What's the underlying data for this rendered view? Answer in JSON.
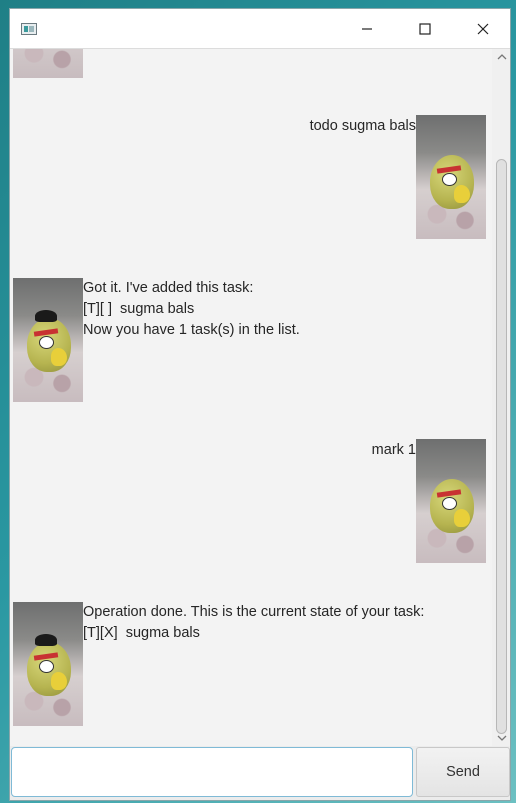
{
  "window": {
    "icon": "app-window-icon",
    "controls": [
      "minimize-icon",
      "maximize-icon",
      "close-icon"
    ]
  },
  "dialogs": [
    {
      "from": "user",
      "text": "todo sugma bals"
    },
    {
      "from": "bot",
      "text": "Got it. I've added this task:\n[T][ ]  sugma bals\nNow you have 1 task(s) in the list."
    },
    {
      "from": "user",
      "text": "mark 1"
    },
    {
      "from": "bot",
      "text": "Operation done. This is the current state of your task:\n[T][X]  sugma bals"
    }
  ],
  "input": {
    "value": "",
    "placeholder": ""
  },
  "send": {
    "label": "Send"
  }
}
